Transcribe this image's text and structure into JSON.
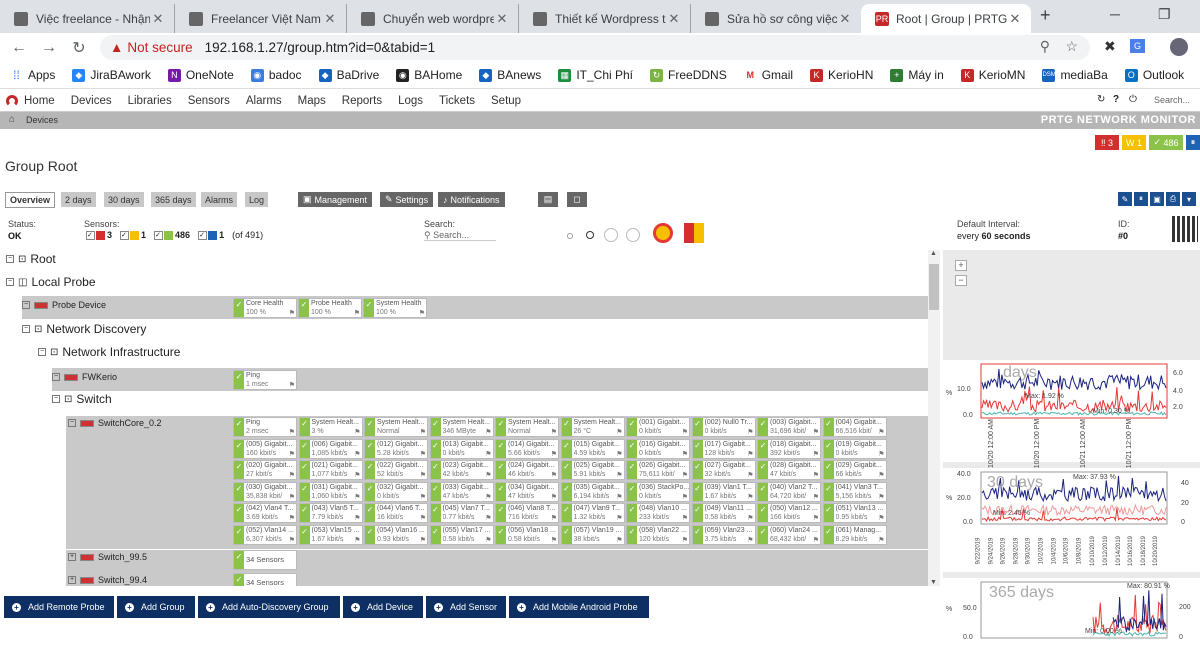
{
  "browser": {
    "tabs": [
      {
        "title": "Việc freelance - Nhận t"
      },
      {
        "title": "Freelancer Việt Nam - L"
      },
      {
        "title": "Chuyển web wordpress"
      },
      {
        "title": "Thiết kế Wordpress the"
      },
      {
        "title": "Sửa hồ sơ công việc củ"
      },
      {
        "title": "Root | Group | PRTG Ne"
      }
    ],
    "new_tab": "+",
    "not_secure": "Not secure",
    "url": "192.168.1.27/group.htm?id=0&tabid=1",
    "bookmarks": [
      "Apps",
      "JiraBAwork",
      "OneNote",
      "badoc",
      "BaDrive",
      "BAHome",
      "BAnews",
      "IT_Chi Phí",
      "FreeDDNS",
      "Gmail",
      "KerioHN",
      "Máy in",
      "KerioMN",
      "mediaBa",
      "Outlook"
    ]
  },
  "menu": {
    "items": [
      "Home",
      "Devices",
      "Libraries",
      "Sensors",
      "Alarms",
      "Maps",
      "Reports",
      "Logs",
      "Tickets",
      "Setup"
    ],
    "search_placeholder": "Search..."
  },
  "breadcrumb": "Devices",
  "brand": "PRTG NETWORK MONITOR",
  "status_boxes": {
    "down": "3",
    "warning": "1",
    "up": "486"
  },
  "page_title": "Group Root",
  "view_tabs": [
    "Overview",
    "2 days",
    "30 days",
    "365 days",
    "Alarms",
    "Log"
  ],
  "group_buttons": {
    "management": "Management",
    "settings": "Settings",
    "notifications": "Notifications"
  },
  "status": {
    "status_label": "Status:",
    "status_value": "OK",
    "sensors_label": "Sensors:",
    "down": "3",
    "warning": "1",
    "up": "486",
    "paused": "1",
    "total": "(of 491)",
    "search_label": "Search:",
    "search_placeholder": "Search...",
    "interval_label": "Default Interval:",
    "interval_value_prefix": "every",
    "interval_value": "60 seconds",
    "id_label": "ID:",
    "id_value": "#0"
  },
  "tree": {
    "root": "Root",
    "local_probe": "Local Probe",
    "probe_device": "Probe Device",
    "network_discovery": "Network Discovery",
    "network_infrastructure": "Network Infrastructure",
    "fwkerio": "FWKerio",
    "switch": "Switch",
    "switchcore": "SwitchCore_0.2",
    "switch_99_5": "Switch_99.5",
    "switch_99_4": "Switch_99.4",
    "sensors_34": "34 Sensors"
  },
  "probe_sensors": [
    {
      "name": "Core Health",
      "value": "100 %"
    },
    {
      "name": "Probe Health",
      "value": "100 %"
    },
    {
      "name": "System Health",
      "value": "100 %"
    }
  ],
  "fw_sensors": [
    {
      "name": "Ping",
      "value": "1 msec"
    }
  ],
  "core_sensors": [
    {
      "name": "Ping",
      "value": "2 msec"
    },
    {
      "name": "System Healt...",
      "value": "3 %"
    },
    {
      "name": "System Healt...",
      "value": "Normal"
    },
    {
      "name": "System Healt...",
      "value": "346 MByte"
    },
    {
      "name": "System Healt...",
      "value": "Normal"
    },
    {
      "name": "System Healt...",
      "value": "26 °C"
    },
    {
      "name": "(001) Gigabit...",
      "value": "0 kbit/s"
    },
    {
      "name": "(002) Null0 Tr...",
      "value": "0 kbit/s"
    },
    {
      "name": "(003) Gigabit...",
      "value": "31,696 kbit/"
    },
    {
      "name": "(004) Gigabit...",
      "value": "66,516 kbit/"
    },
    {
      "name": "(005) Gigabit...",
      "value": "160 kbit/s"
    },
    {
      "name": "(006) Gigabit...",
      "value": "1,085 kbit/s"
    },
    {
      "name": "(012) Gigabit...",
      "value": "5.28 kbit/s"
    },
    {
      "name": "(013) Gigabit...",
      "value": "0 kbit/s"
    },
    {
      "name": "(014) Gigabit...",
      "value": "5.66 kbit/s"
    },
    {
      "name": "(015) Gigabit...",
      "value": "4.59 kbit/s"
    },
    {
      "name": "(016) Gigabit...",
      "value": "0 kbit/s"
    },
    {
      "name": "(017) Gigabit...",
      "value": "128 kbit/s"
    },
    {
      "name": "(018) Gigabit...",
      "value": "392 kbit/s"
    },
    {
      "name": "(019) Gigabit...",
      "value": "0 kbit/s"
    },
    {
      "name": "(020) Gigabit...",
      "value": "27 kbit/s"
    },
    {
      "name": "(021) Gigabit...",
      "value": "1,077 kbit/s"
    },
    {
      "name": "(022) Gigabit...",
      "value": "52 kbit/s"
    },
    {
      "name": "(023) Gigabit...",
      "value": "42 kbit/s"
    },
    {
      "name": "(024) Gigabit...",
      "value": "46 kbit/s"
    },
    {
      "name": "(025) Gigabit...",
      "value": "5.91 kbit/s"
    },
    {
      "name": "(026) Gigabit...",
      "value": "75,611 kbit/"
    },
    {
      "name": "(027) Gigabit...",
      "value": "32 kbit/s"
    },
    {
      "name": "(028) Gigabit...",
      "value": "47 kbit/s"
    },
    {
      "name": "(029) Gigabit...",
      "value": "66 kbit/s"
    },
    {
      "name": "(030) Gigabit...",
      "value": "35,838 kbit/"
    },
    {
      "name": "(031) Gigabit...",
      "value": "1,060 kbit/s"
    },
    {
      "name": "(032) Gigabit...",
      "value": "0 kbit/s"
    },
    {
      "name": "(033) Gigabit...",
      "value": "47 kbit/s"
    },
    {
      "name": "(034) Gigabit...",
      "value": "47 kbit/s"
    },
    {
      "name": "(035) Gigabit...",
      "value": "6,194 kbit/s"
    },
    {
      "name": "(036) StackPo...",
      "value": "0 kbit/s"
    },
    {
      "name": "(039) Vlan1 T...",
      "value": "1.67 kbit/s"
    },
    {
      "name": "(040) Vlan2 T...",
      "value": "64,720 kbit/"
    },
    {
      "name": "(041) Vlan3 T...",
      "value": "5,156 kbit/s"
    },
    {
      "name": "(042) Vlan4 T...",
      "value": "3.69 kbit/s"
    },
    {
      "name": "(043) Vlan5 T...",
      "value": "7.79 kbit/s"
    },
    {
      "name": "(044) Vlan6 T...",
      "value": "16 kbit/s"
    },
    {
      "name": "(045) Vlan7 T...",
      "value": "0.77 kbit/s"
    },
    {
      "name": "(046) Vlan8 T...",
      "value": "716 kbit/s"
    },
    {
      "name": "(047) Vlan9 T...",
      "value": "1.32 kbit/s"
    },
    {
      "name": "(048) Vlan10 ...",
      "value": "233 kbit/s"
    },
    {
      "name": "(049) Vlan11 ...",
      "value": "0.58 kbit/s"
    },
    {
      "name": "(050) Vlan12 ...",
      "value": "166 kbit/s"
    },
    {
      "name": "(051) Vlan13 ...",
      "value": "0.95 kbit/s"
    },
    {
      "name": "(052) Vlan14 ...",
      "value": "6,307 kbit/s"
    },
    {
      "name": "(053) Vlan15 ...",
      "value": "1.67 kbit/s"
    },
    {
      "name": "(054) Vlan16 ...",
      "value": "0.93 kbit/s"
    },
    {
      "name": "(055) Vlan17 ...",
      "value": "0.58 kbit/s"
    },
    {
      "name": "(056) Vlan18 ...",
      "value": "0.58 kbit/s"
    },
    {
      "name": "(057) Vlan19 ...",
      "value": "38 kbit/s"
    },
    {
      "name": "(058) Vlan22 ...",
      "value": "120 kbit/s"
    },
    {
      "name": "(059) Vlan23 ...",
      "value": "3.75 kbit/s"
    },
    {
      "name": "(060) Vlan24 ...",
      "value": "68,432 kbit/"
    },
    {
      "name": "(061) Manag...",
      "value": "8.29 kbit/s"
    }
  ],
  "actions": [
    "Add Remote Probe",
    "Add Group",
    "Add Auto-Discovery Group",
    "Add Device",
    "Add Sensor",
    "Add Mobile Android Probe"
  ],
  "graphs": [
    {
      "title": "days",
      "y_left": [
        "10.0",
        "0.0"
      ],
      "y_right": [
        "6.0",
        "4.0",
        "2.0"
      ],
      "max": "Max: 1.92 %",
      "min": "Min: 0.30 %",
      "x": [
        "10/20 12:00 AM",
        "10/20 12:00 PM",
        "10/21 12:00 AM",
        "10/21 12:00 PM"
      ]
    },
    {
      "title": "30 days",
      "y_left": [
        "40.0",
        "20.0",
        "0.0"
      ],
      "y_right": [
        "40",
        "20",
        "0"
      ],
      "max": "Max: 37.93 %",
      "min": "Min: 2.45 %",
      "x": [
        "9/22/2019",
        "9/24/2019",
        "9/26/2019",
        "9/28/2019",
        "9/30/2019",
        "10/2/2019",
        "10/4/2019",
        "10/6/2019",
        "10/8/2019",
        "10/10/2019",
        "10/12/2019",
        "10/14/2019",
        "10/16/2019",
        "10/18/2019",
        "10/20/2019"
      ]
    },
    {
      "title": "365 days",
      "y_left": [
        "50.0",
        "0.0"
      ],
      "y_right": [
        "200",
        "0"
      ],
      "max": "Max: 80.91 %",
      "min": "Min: 0.00 %"
    }
  ],
  "colors": {
    "down": "#d32f2f",
    "warning": "#f6c000",
    "up": "#8bc34a",
    "paused": "#1e63b4",
    "navy": "#0d2f63",
    "graph_red": "#e53935",
    "graph_blue": "#1a237e"
  }
}
